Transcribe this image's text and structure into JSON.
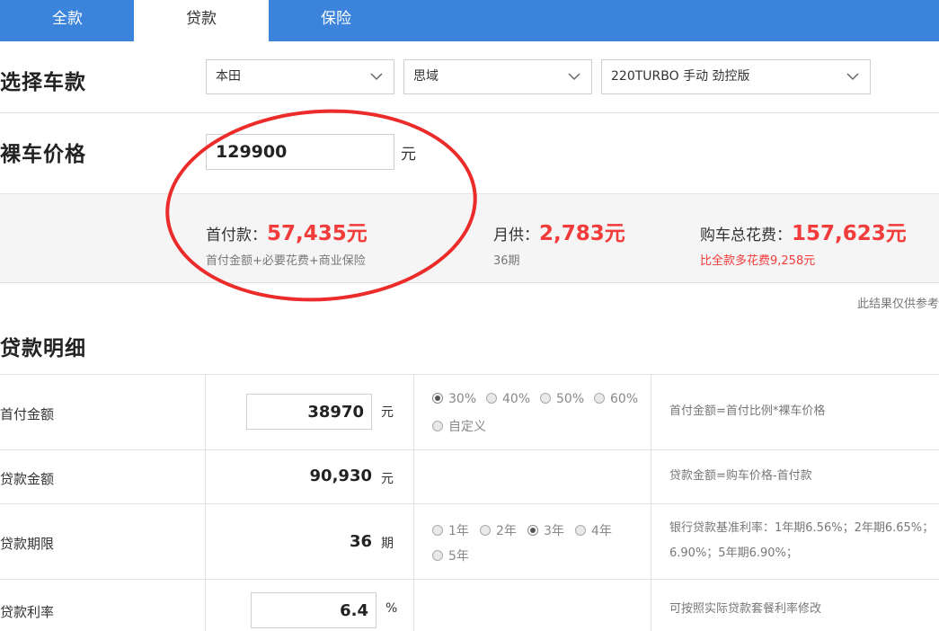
{
  "tabs": [
    {
      "label": "全款",
      "active": false
    },
    {
      "label": "贷款",
      "active": true
    },
    {
      "label": "保险",
      "active": false
    }
  ],
  "choose_car": {
    "title": "选择车款",
    "brand": "本田",
    "model": "思域",
    "trim": "220TURBO 手动 劲控版"
  },
  "price": {
    "title": "裸车价格",
    "value": "129900",
    "unit": "元"
  },
  "summary": {
    "down_label": "首付款：",
    "down_value": "57,435元",
    "down_sub": "首付金额+必要花费+商业保险",
    "monthly_label": "月供：",
    "monthly_value": "2,783元",
    "monthly_sub": "36期",
    "total_label": "购车总花费：",
    "total_value": "157,623元",
    "total_sub": "比全款多花费9,258元"
  },
  "disclaimer": "此结果仅供参考",
  "loan_detail": {
    "title": "贷款明细",
    "rows": {
      "down": {
        "label": "首付金额",
        "value": "38970",
        "unit": "元",
        "options": [
          "30%",
          "40%",
          "50%",
          "60%",
          "自定义"
        ],
        "selected": "30%",
        "note": "首付金额=首付比例*裸车价格"
      },
      "amount": {
        "label": "贷款金额",
        "value": "90,930",
        "unit": "元",
        "note": "贷款金额=购车价格-首付款"
      },
      "term": {
        "label": "贷款期限",
        "value": "36",
        "unit": "期",
        "options": [
          "1年",
          "2年",
          "3年",
          "4年",
          "5年"
        ],
        "selected": "3年",
        "note_line1": "银行贷款基准利率：1年期6.56%；2年期6.65%；",
        "note_line2": "6.90%；5年期6.90%；"
      },
      "rate": {
        "label": "贷款利率",
        "value": "6.4",
        "unit": "%",
        "note": "可按照实际贷款套餐利率修改"
      }
    }
  },
  "colors": {
    "tab_bar": "#3c83dc",
    "highlight_red": "#f23b3b",
    "annotation_circle": "#ec2b2b"
  }
}
